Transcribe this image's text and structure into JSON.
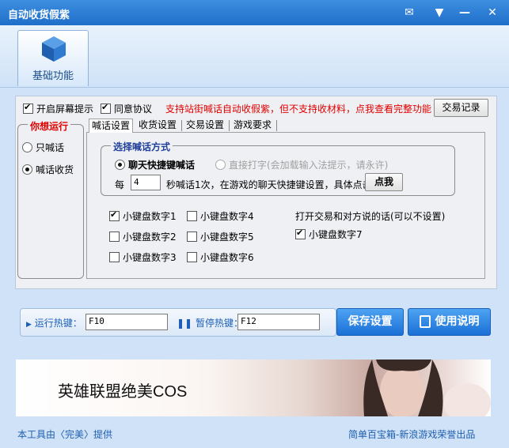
{
  "window": {
    "title": "自动收货假紫"
  },
  "toolbar": {
    "basic_label": "基础功能"
  },
  "options": {
    "screen_tip": {
      "label": "开启屏幕提示",
      "checked": true
    },
    "agree": {
      "label": "同意协议",
      "checked": true
    },
    "notice": "支持站街喊话自动收假紫，但不支持收材料，点我查看完整功能",
    "trade_log": "交易记录"
  },
  "run_mode": {
    "title": "你想运行",
    "options": [
      {
        "label": "只喊话",
        "selected": false
      },
      {
        "label": "喊话收货",
        "selected": true
      }
    ]
  },
  "tabs": [
    "喊话设置",
    "收货设置",
    "交易设置",
    "游戏要求"
  ],
  "shout": {
    "group_title": "选择喊话方式",
    "mode_quick": "聊天快捷键喊话",
    "mode_direct": "直接打字(会加载输入法提示，请永许)",
    "every_label": "每",
    "seconds_value": "4",
    "desc": "秒喊话1次，在游戏的聊天快捷键设置，具体点击",
    "click_btn": "点我"
  },
  "keypad": [
    {
      "label": "小键盘数字1",
      "checked": true
    },
    {
      "label": "小键盘数字2",
      "checked": false
    },
    {
      "label": "小键盘数字3",
      "checked": false
    },
    {
      "label": "小键盘数字4",
      "checked": false
    },
    {
      "label": "小键盘数字5",
      "checked": false
    },
    {
      "label": "小键盘数字6",
      "checked": false
    }
  ],
  "trade_talk": {
    "note": "打开交易和对方说的话(可以不设置)",
    "key7": {
      "label": "小键盘数字7",
      "checked": true
    }
  },
  "hotkeys": {
    "run_label": "运行热键：",
    "run_value": "F10",
    "pause_label": "暂停热键：",
    "pause_value": "F12"
  },
  "actions": {
    "save": "保存设置",
    "help": "使用说明"
  },
  "banner": {
    "text": "英雄联盟绝美COS"
  },
  "footer": {
    "left": "本工具由〈完美〉提供",
    "right": "简单百宝箱-新浪游戏荣誉出品"
  }
}
